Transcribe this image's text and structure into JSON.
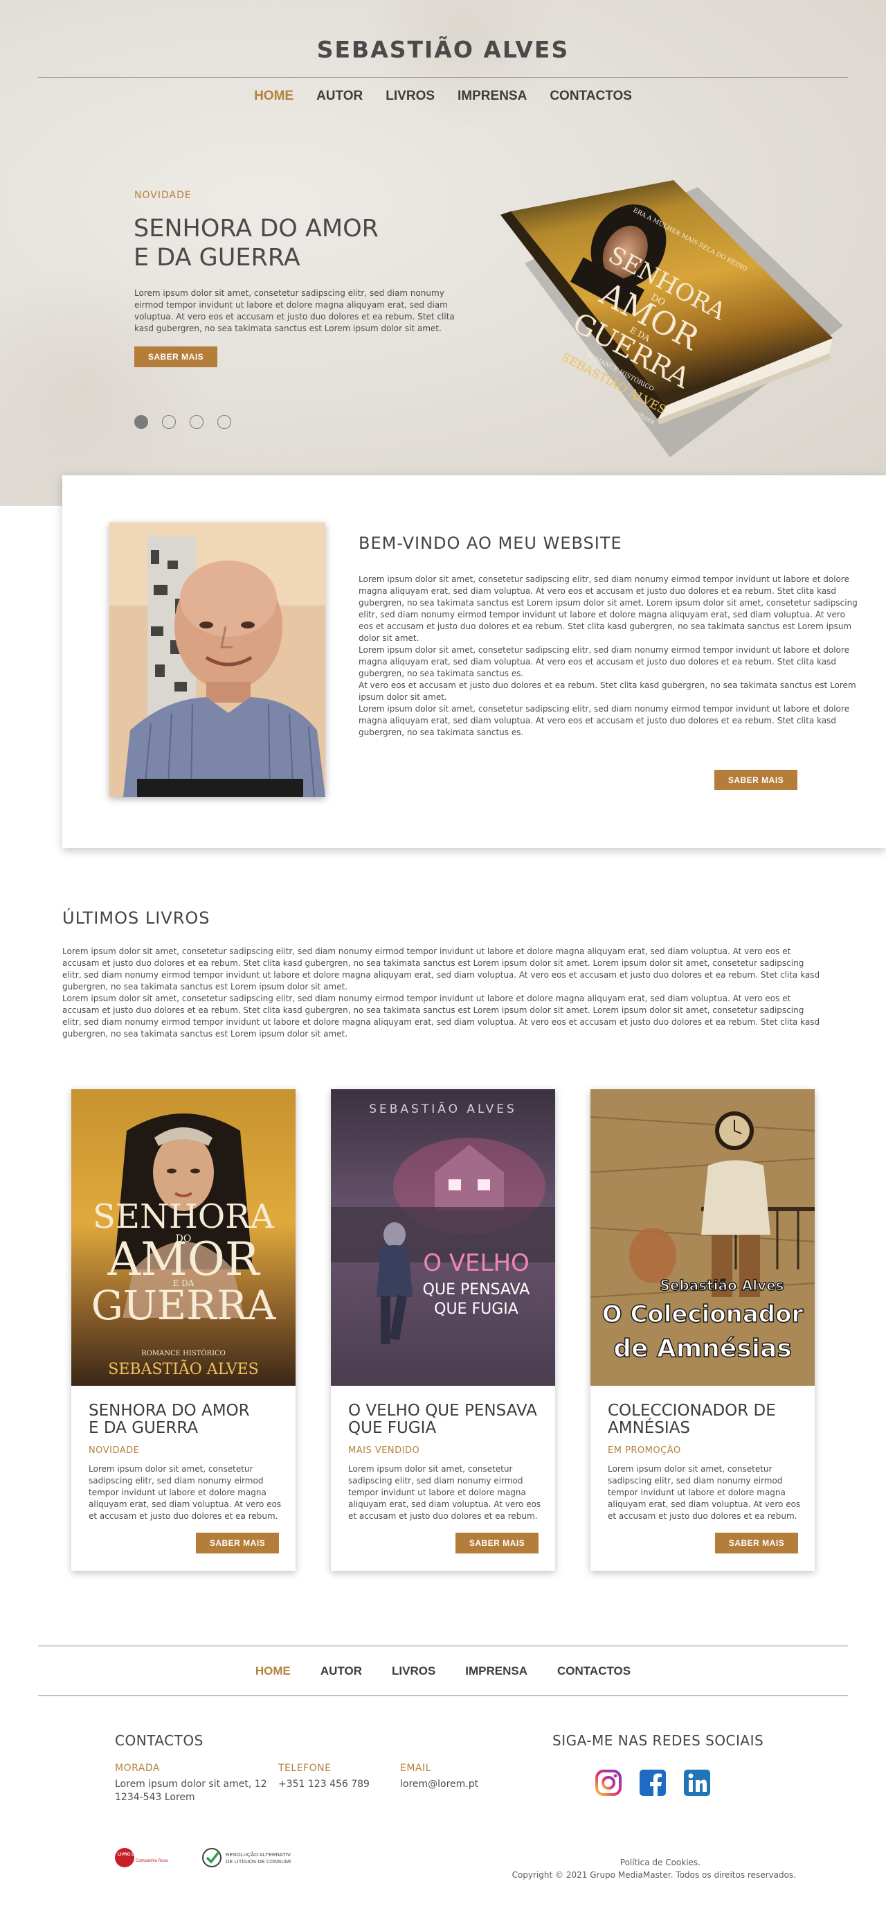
{
  "site": {
    "title": "SEBASTIÃO ALVES"
  },
  "nav": {
    "items": [
      "HOME",
      "AUTOR",
      "LIVROS",
      "IMPRENSA",
      "CONTACTOS"
    ],
    "active": "HOME"
  },
  "hero": {
    "badge": "NOVIDADE",
    "title_line1": "SENHORA DO AMOR",
    "title_line2": "E DA GUERRA",
    "text": "Lorem ipsum dolor sit amet, consetetur sadipscing elitr, sed diam nonumy eirmod tempor invidunt ut labore et dolore magna aliquyam erat, sed diam voluptua. At vero eos et accusam et justo duo dolores et ea rebum. Stet clita kasd gubergren, no sea takimata sanctus est Lorem ipsum dolor sit amet.",
    "button": "SABER MAIS",
    "slides": 4,
    "active_slide": 1,
    "book": {
      "top_text": "ERA A MULHER MAIS BELA DO REINO",
      "word1": "SENHORA",
      "word2": "DO",
      "word3": "AMOR",
      "word4": "E DA",
      "word5": "GUERRA",
      "genre": "ROMANCE HISTÓRICO",
      "author": "SEBASTIÃO ALVES",
      "publisher": "cultura"
    }
  },
  "welcome": {
    "title": "BEM-VINDO AO MEU WEBSITE",
    "paragraphs": [
      "Lorem ipsum dolor sit amet, consetetur sadipscing elitr, sed diam nonumy eirmod tempor invidunt ut labore et dolore magna aliquyam erat, sed diam voluptua. At vero eos et accusam et justo duo dolores et ea rebum. Stet clita kasd gubergren, no sea takimata sanctus est Lorem ipsum dolor sit amet. Lorem ipsum dolor sit amet, consetetur sadipscing elitr, sed diam nonumy eirmod tempor invidunt ut labore et dolore magna aliquyam erat, sed diam voluptua. At vero eos et accusam et justo duo dolores et ea rebum. Stet clita kasd gubergren, no sea takimata sanctus est Lorem ipsum dolor sit amet.",
      "Lorem ipsum dolor sit amet, consetetur sadipscing elitr, sed diam nonumy eirmod tempor invidunt ut labore et dolore magna aliquyam erat, sed diam voluptua. At vero eos et accusam et justo duo dolores et ea rebum. Stet clita kasd gubergren, no sea takimata sanctus es.",
      "At vero eos et accusam et justo duo dolores et ea rebum. Stet clita kasd gubergren, no sea takimata sanctus est Lorem ipsum dolor sit amet.",
      "Lorem ipsum dolor sit amet, consetetur sadipscing elitr, sed diam nonumy eirmod tempor invidunt ut labore et dolore magna aliquyam erat, sed diam voluptua. At vero eos et accusam et justo duo dolores et ea rebum. Stet clita kasd gubergren, no sea takimata sanctus es."
    ],
    "button": "SABER MAIS"
  },
  "latest": {
    "title": "ÚLTIMOS LIVROS",
    "paragraphs": [
      "Lorem ipsum dolor sit amet, consetetur sadipscing elitr, sed diam nonumy eirmod tempor invidunt ut labore et dolore magna aliquyam erat, sed diam voluptua. At vero eos et accusam et justo duo dolores et ea rebum. Stet clita kasd gubergren, no sea takimata sanctus est Lorem ipsum dolor sit amet. Lorem ipsum dolor sit amet, consetetur sadipscing elitr, sed diam nonumy eirmod tempor invidunt ut labore et dolore magna aliquyam erat, sed diam voluptua. At vero eos et accusam et justo duo dolores et ea rebum. Stet clita kasd gubergren, no sea takimata sanctus est Lorem ipsum dolor sit amet.",
      "Lorem ipsum dolor sit amet, consetetur sadipscing elitr, sed diam nonumy eirmod tempor invidunt ut labore et dolore magna aliquyam erat, sed diam voluptua. At vero eos et accusam et justo duo dolores et ea rebum. Stet clita kasd gubergren, no sea takimata sanctus est Lorem ipsum dolor sit amet. Lorem ipsum dolor sit amet, consetetur sadipscing elitr, sed diam nonumy eirmod tempor invidunt ut labore et dolore magna aliquyam erat, sed diam voluptua. At vero eos et accusam et justo duo dolores et ea rebum. Stet clita kasd gubergren, no sea takimata sanctus est Lorem ipsum dolor sit amet."
    ],
    "books": [
      {
        "title_line1": "SENHORA DO AMOR",
        "title_line2": "E DA GUERRA",
        "tag": "NOVIDADE",
        "text": "Lorem ipsum dolor sit amet, consetetur sadipscing elitr, sed diam nonumy eirmod tempor invidunt ut labore et dolore magna aliquyam erat, sed diam voluptua. At vero eos et accusam et justo duo dolores et ea rebum.",
        "button": "SABER MAIS",
        "cover": {
          "w1": "SENHORA",
          "w2": "DO",
          "w3": "AMOR",
          "w4": "E DA",
          "w5": "GUERRA",
          "genre": "ROMANCE HISTÓRICO",
          "author": "SEBASTIÃO ALVES"
        }
      },
      {
        "title_line1": "O VELHO QUE PENSAVA",
        "title_line2": "QUE FUGIA",
        "tag": "MAIS VENDIDO",
        "text": "Lorem ipsum dolor sit amet, consetetur sadipscing elitr, sed diam nonumy eirmod tempor invidunt ut labore et dolore magna aliquyam erat, sed diam voluptua. At vero eos et accusam et justo duo dolores et ea rebum.",
        "button": "SABER MAIS",
        "cover": {
          "author": "SEBASTIÃO ALVES",
          "w1": "O VELHO",
          "w2": "QUE PENSAVA",
          "w3": "QUE FUGIA"
        }
      },
      {
        "title_line1": "COLECCIONADOR DE",
        "title_line2": "AMNÉSIAS",
        "tag": "EM PROMOÇÃO",
        "text": "Lorem ipsum dolor sit amet, consetetur sadipscing elitr, sed diam nonumy eirmod tempor invidunt ut labore et dolore magna aliquyam erat, sed diam voluptua. At vero eos et accusam et justo duo dolores et ea rebum.",
        "button": "SABER MAIS",
        "cover": {
          "author": "Sebastião Alves",
          "w1": "O Colecionador",
          "w2": "de Amnésias"
        }
      }
    ]
  },
  "footer": {
    "contacts_title": "CONTACTOS",
    "address_label": "MORADA",
    "address_line1": "Lorem ipsum dolor sit amet, 12",
    "address_line2": "1234-543 Lorem",
    "phone_label": "TELEFONE",
    "phone": "+351 123 456 789",
    "email_label": "EMAIL",
    "email": "lorem@lorem.pt",
    "social_title": "SIGA-ME NAS REDES SOCIAIS",
    "social": [
      "instagram-icon",
      "facebook-icon",
      "linkedin-icon"
    ],
    "complaints_logo_line1": "LIVRO DE RECLAMAÇÕES",
    "complaints_logo_line2": "Companhia Rosa",
    "adr_logo_line1": "RESOLUÇÃO ALTERNATIVA",
    "adr_logo_line2": "DE LITÍGIOS DE CONSUMO",
    "cookies": "Política de Cookies.",
    "copyright": "Copyright © 2021 Grupo MediaMaster. Todos os direitos reservados."
  },
  "colors": {
    "accent": "#b5813b",
    "button": "#b47e3a",
    "text": "#3c3c3c"
  }
}
